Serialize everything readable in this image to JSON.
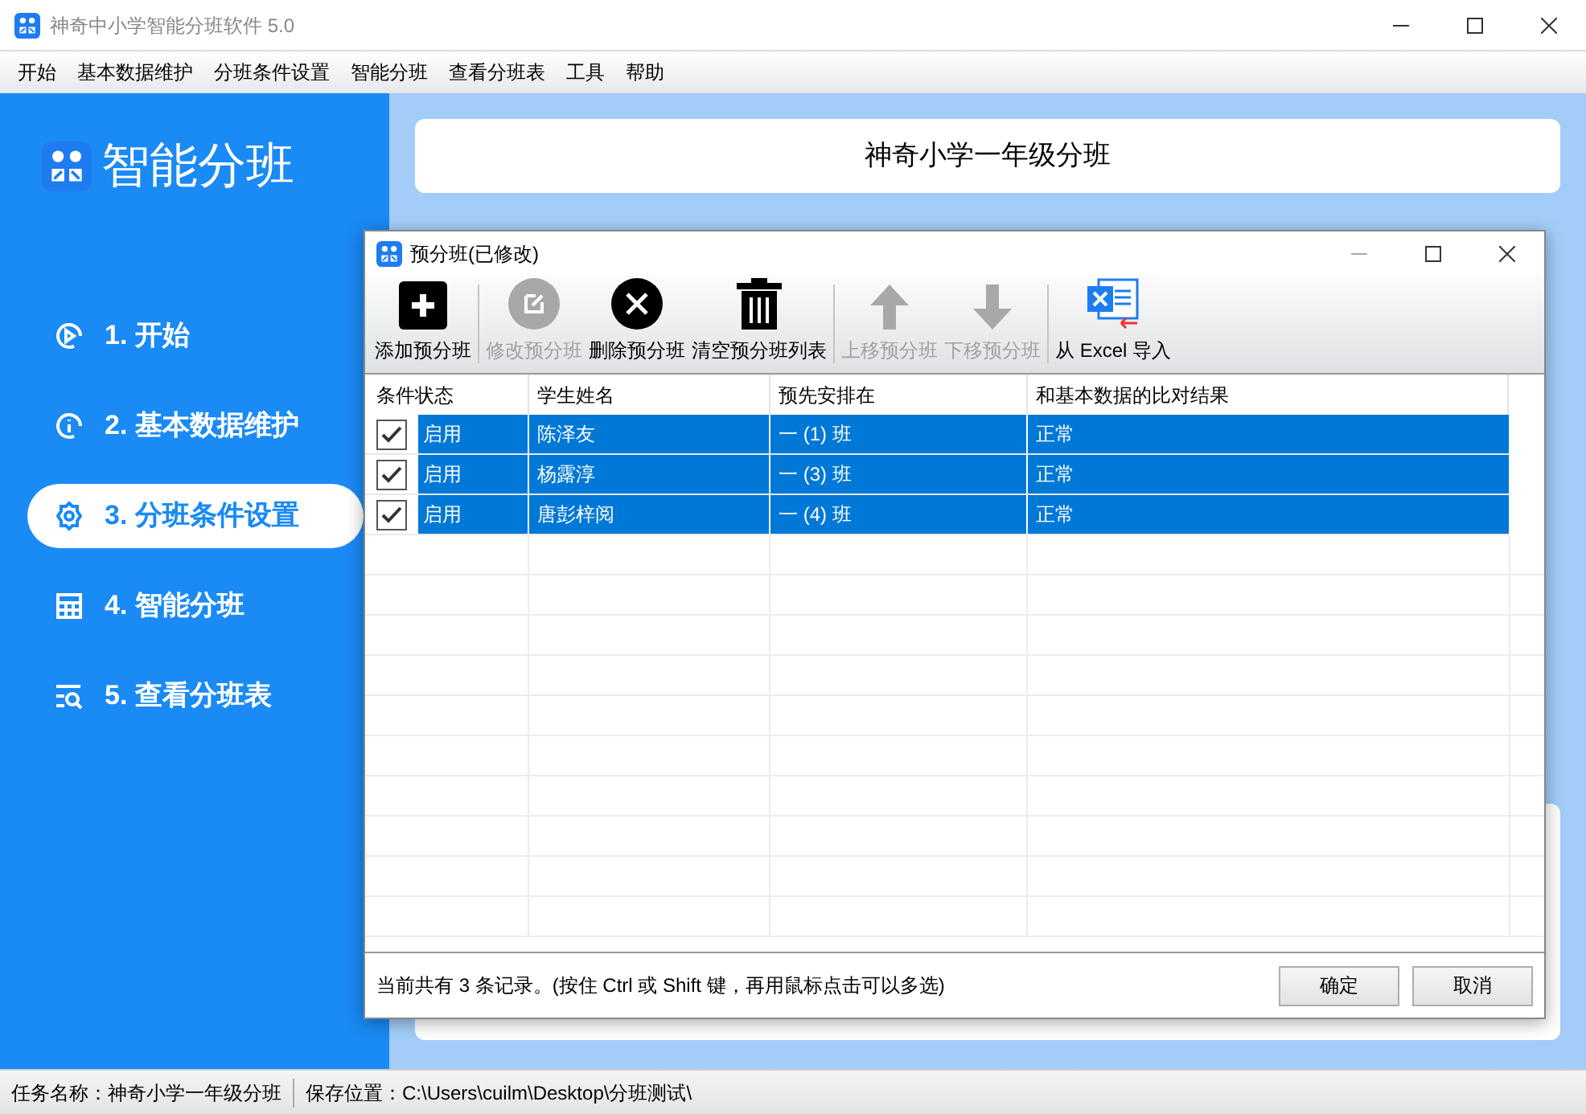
{
  "window": {
    "title": "神奇中小学智能分班软件 5.0"
  },
  "menu": [
    "开始",
    "基本数据维护",
    "分班条件设置",
    "智能分班",
    "查看分班表",
    "工具",
    "帮助"
  ],
  "sidebar": {
    "title": "智能分班",
    "items": [
      {
        "label": "1. 开始",
        "selected": false
      },
      {
        "label": "2. 基本数据维护",
        "selected": false
      },
      {
        "label": "3. 分班条件设置",
        "selected": true
      },
      {
        "label": "4. 智能分班",
        "selected": false
      },
      {
        "label": "5. 查看分班表",
        "selected": false
      }
    ]
  },
  "header": {
    "title": "神奇小学一年级分班"
  },
  "dialog": {
    "title": "预分班(已修改)",
    "toolbar": [
      {
        "label": "添加预分班",
        "disabled": false
      },
      {
        "label": "修改预分班",
        "disabled": true
      },
      {
        "label": "删除预分班",
        "disabled": false
      },
      {
        "label": "清空预分班列表",
        "disabled": false
      },
      {
        "label": "上移预分班",
        "disabled": true
      },
      {
        "label": "下移预分班",
        "disabled": true
      },
      {
        "label": "从 Excel 导入",
        "disabled": false
      }
    ],
    "table": {
      "columns": [
        "条件状态",
        "学生姓名",
        "预先安排在",
        "和基本数据的比对结果"
      ],
      "rows": [
        {
          "checked": true,
          "status": "启用",
          "name": "陈泽友",
          "placement": "一 (1) 班",
          "result": "正常",
          "selected": true
        },
        {
          "checked": true,
          "status": "启用",
          "name": "杨露淳",
          "placement": "一 (3) 班",
          "result": "正常",
          "selected": true
        },
        {
          "checked": true,
          "status": "启用",
          "name": "唐彭梓阅",
          "placement": "一 (4) 班",
          "result": "正常",
          "selected": true
        }
      ]
    },
    "footer_text": "当前共有 3 条记录。(按住 Ctrl 或 Shift 键，再用鼠标点击可以多选)",
    "buttons": [
      "确定",
      "取消"
    ]
  },
  "status_bar": {
    "task": "任务名称：神奇小学一年级分班",
    "location": "保存位置：C:\\Users\\cuilm\\Desktop\\分班测试\\"
  }
}
